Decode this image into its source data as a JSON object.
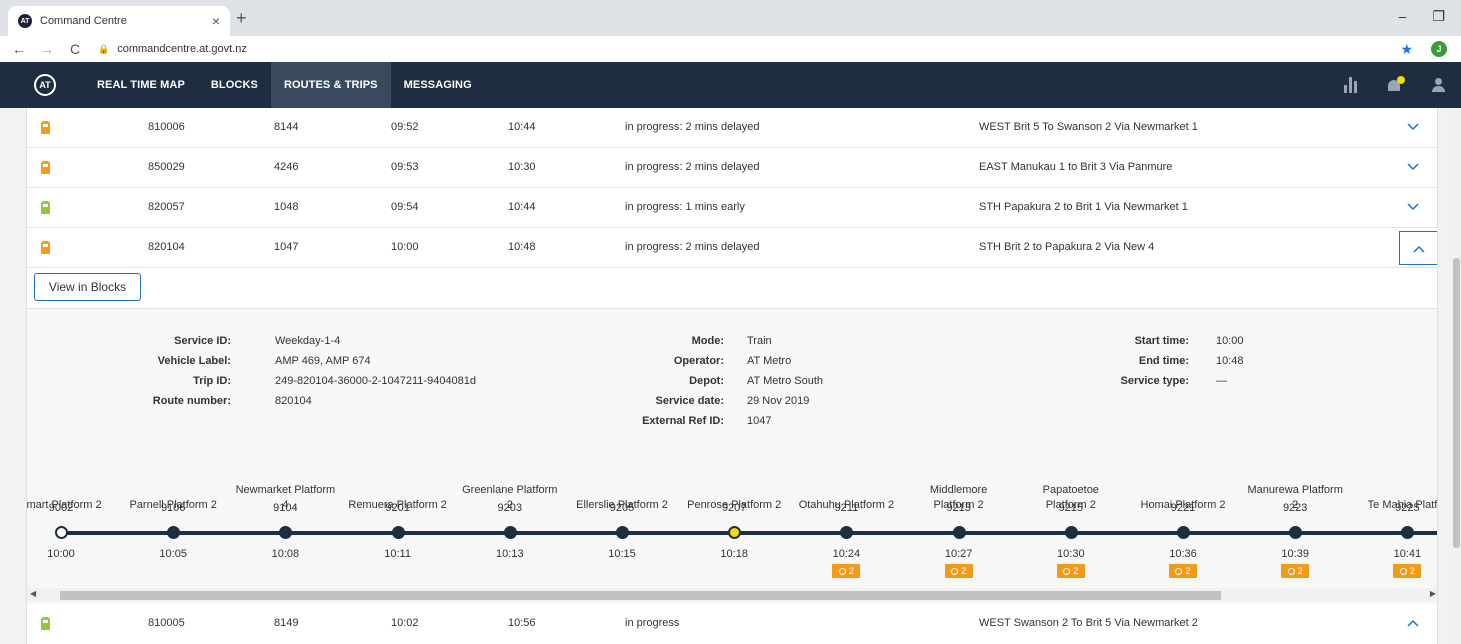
{
  "browser": {
    "tab_title": "Command Centre",
    "tab_close": "×",
    "new_tab": "+",
    "url": "commandcentre.at.govt.nz",
    "profile_initial": "J",
    "favicon_text": "AT"
  },
  "nav": {
    "logo": "AT",
    "items": [
      "REAL TIME MAP",
      "BLOCKS",
      "ROUTES & TRIPS",
      "MESSAGING"
    ],
    "active": "ROUTES & TRIPS"
  },
  "trips": [
    {
      "route": "810006",
      "trip": "8144",
      "start": "09:52",
      "end": "10:44",
      "status": "in progress: 2 mins delayed",
      "description": "WEST Brit 5 To Swanson 2 Via Newmarket 1",
      "icon_color": "orange"
    },
    {
      "route": "850029",
      "trip": "4246",
      "start": "09:53",
      "end": "10:30",
      "status": "in progress: 2 mins delayed",
      "description": "EAST Manukau 1 to Brit 3 Via Panmure",
      "icon_color": "orange"
    },
    {
      "route": "820057",
      "trip": "1048",
      "start": "09:54",
      "end": "10:44",
      "status": "in progress: 1 mins early",
      "description": "STH Papakura 2 to Brit 1 Via Newmarket 1",
      "icon_color": "green"
    },
    {
      "route": "820104",
      "trip": "1047",
      "start": "10:00",
      "end": "10:48",
      "status": "in progress: 2 mins delayed",
      "description": "STH Brit 2 to Papakura 2 Via New 4",
      "icon_color": "orange",
      "expanded": true
    }
  ],
  "next_trip": {
    "route": "810005",
    "trip": "8149",
    "start": "10:02",
    "end": "10:56",
    "status": "in progress",
    "description": "WEST Swanson 2 To Brit 5 Via Newmarket 2",
    "icon_color": "green"
  },
  "view_in_blocks": "View in Blocks",
  "details": {
    "col1": [
      {
        "k": "Service ID:",
        "v": "Weekday-1-4"
      },
      {
        "k": "Vehicle Label:",
        "v": "AMP 469, AMP 674"
      },
      {
        "k": "Trip ID:",
        "v": "249-820104-36000-2-1047211-9404081d"
      },
      {
        "k": "Route number:",
        "v": "820104"
      }
    ],
    "col2": [
      {
        "k": "Mode:",
        "v": "Train"
      },
      {
        "k": "Operator:",
        "v": "AT Metro"
      },
      {
        "k": "Depot:",
        "v": "AT Metro South"
      },
      {
        "k": "Service date:",
        "v": "29 Nov 2019"
      },
      {
        "k": "External Ref ID:",
        "v": "1047"
      }
    ],
    "col3": [
      {
        "k": "Start time:",
        "v": "10:00"
      },
      {
        "k": "End time:",
        "v": "10:48"
      },
      {
        "k": "Service type:",
        "v": "—"
      }
    ]
  },
  "stops": [
    {
      "name": "omart Platform 2",
      "code": "9002",
      "time": "10:00",
      "state": "start",
      "delay": null
    },
    {
      "name": "Parnell Platform 2",
      "code": "9106",
      "time": "10:05",
      "state": "done",
      "delay": null
    },
    {
      "name": "Newmarket Platform 4",
      "code": "9104",
      "time": "10:08",
      "state": "done",
      "delay": null
    },
    {
      "name": "Remuera Platform 2",
      "code": "9201",
      "time": "10:11",
      "state": "done",
      "delay": null
    },
    {
      "name": "Greenlane Platform 2",
      "code": "9203",
      "time": "10:13",
      "state": "done",
      "delay": null
    },
    {
      "name": "Ellerslie Platform 2",
      "code": "9205",
      "time": "10:15",
      "state": "done",
      "delay": null
    },
    {
      "name": "Penrose Platform 2",
      "code": "9207",
      "time": "10:18",
      "state": "current",
      "delay": null
    },
    {
      "name": "Otahuhu Platform 2",
      "code": "9211",
      "time": "10:24",
      "state": "next",
      "delay": "2"
    },
    {
      "name": "Middlemore Platform 2",
      "code": "9213",
      "time": "10:27",
      "state": "next",
      "delay": "2"
    },
    {
      "name": "Papatoetoe Platform 2",
      "code": "9215",
      "time": "10:30",
      "state": "next",
      "delay": "2"
    },
    {
      "name": "Homai Platform 2",
      "code": "9221",
      "time": "10:36",
      "state": "next",
      "delay": "2"
    },
    {
      "name": "Manurewa Platform 2",
      "code": "9223",
      "time": "10:39",
      "state": "next",
      "delay": "2"
    },
    {
      "name": "Te Mahia Platfor",
      "code": "9225",
      "time": "10:41",
      "state": "next",
      "delay": "2"
    }
  ]
}
